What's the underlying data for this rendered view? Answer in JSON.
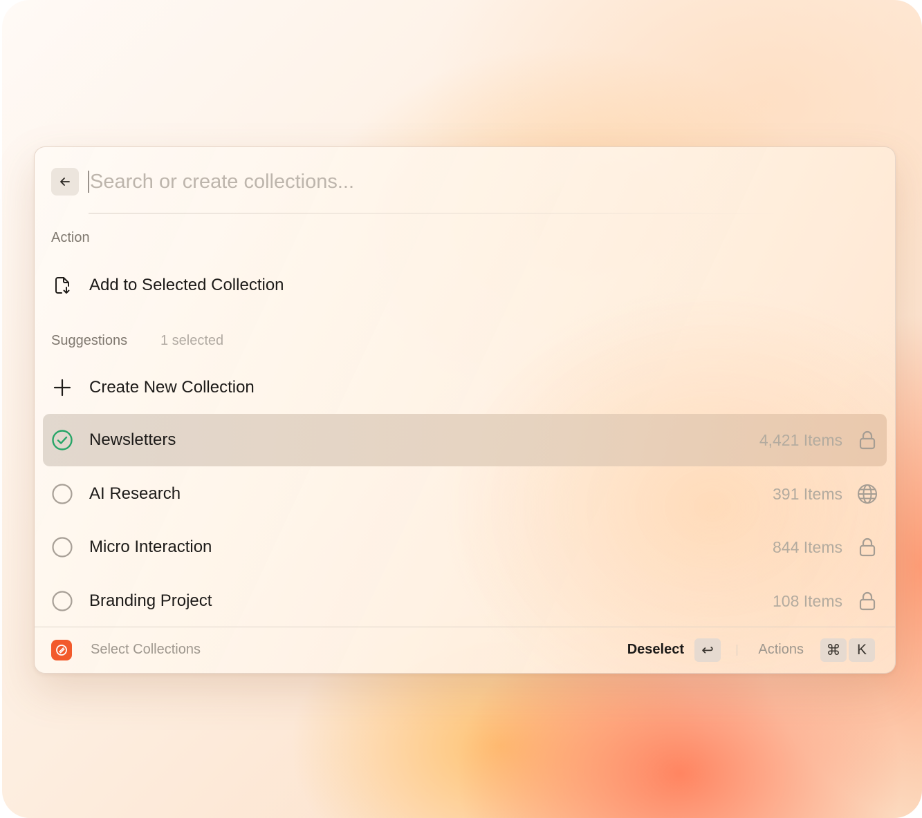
{
  "search": {
    "placeholder": "Search or create collections..."
  },
  "action_section": {
    "title": "Action",
    "items": [
      {
        "label": "Add to Selected Collection",
        "icon": "file-add-icon"
      }
    ]
  },
  "suggestions": {
    "title": "Suggestions",
    "selected_count": "1 selected",
    "create_label": "Create New Collection",
    "collections": [
      {
        "name": "Newsletters",
        "count": "4,421 Items",
        "visibility_icon": "lock-icon",
        "selected": true
      },
      {
        "name": "AI Research",
        "count": "391 Items",
        "visibility_icon": "globe-icon",
        "selected": false
      },
      {
        "name": "Micro Interaction",
        "count": "844 Items",
        "visibility_icon": "lock-icon",
        "selected": false
      },
      {
        "name": "Branding Project",
        "count": "108 Items",
        "visibility_icon": "lock-icon",
        "selected": false
      }
    ]
  },
  "footer": {
    "label": "Select Collections",
    "deselect_label": "Deselect",
    "enter_key": "↩",
    "actions_label": "Actions",
    "cmd_key": "⌘",
    "k_key": "K"
  },
  "colors": {
    "selected_check": "#27a567",
    "app_logo": "#f25a2c"
  }
}
